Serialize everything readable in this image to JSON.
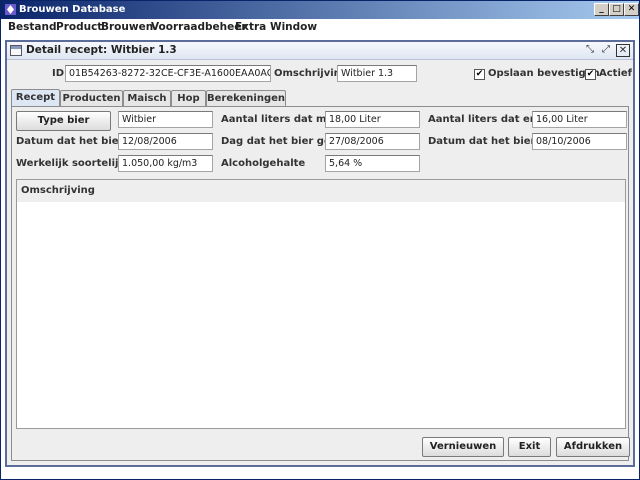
{
  "window": {
    "title": "Brouwen Database",
    "controls": [
      "_",
      "□",
      "✕"
    ]
  },
  "menu": [
    "Bestand",
    "Product",
    "Brouwen",
    "Voorraadbeheer",
    "Extra",
    "Window"
  ],
  "frame": {
    "title": "Detail recept: Witbier 1.3",
    "controls": [
      "⤡",
      "⤢",
      "✕"
    ]
  },
  "header": {
    "id_label": "ID",
    "id_value": "01B54263-8272-32CE-CF3E-A1600EAA0AC0",
    "omschrijving_label": "Omschrijving",
    "omschrijving_value": "Witbier 1.3",
    "opslaan_label": "Opslaan bevestigen",
    "opslaan_checked": true,
    "actief_label": "Actief",
    "actief_checked": true
  },
  "tabs": [
    {
      "label": "Recept",
      "active": true
    },
    {
      "label": "Producten",
      "active": false
    },
    {
      "label": "Maisch",
      "active": false
    },
    {
      "label": "Hop",
      "active": false
    },
    {
      "label": "Berekeningen",
      "active": false
    }
  ],
  "form": {
    "type_bier_button": "Type bier",
    "type_bier_value": "Witbier",
    "liters_me_label": "Aantal liters dat me...",
    "liters_me_value": "18,00 Liter",
    "liters_er_label": "Aantal liters dat er ...",
    "liters_er_value": "16,00 Liter",
    "datum1_label": "Datum dat het bier ...",
    "datum1_value": "12/08/2006",
    "dag_label": "Dag dat het bier ge...",
    "dag_value": "27/08/2006",
    "datum2_label": "Datum dat het bier ...",
    "datum2_value": "08/10/2006",
    "soortelijk_label": "Werkelijk soortelijk...",
    "soortelijk_value": "1.050,00 kg/m3",
    "alcohol_label": "Alcoholgehalte",
    "alcohol_value": "5,64 %",
    "omschrijving_section": "Omschrijving"
  },
  "buttons": {
    "vernieuwen": "Vernieuwen",
    "exit": "Exit",
    "afdrukken": "Afdrukken"
  }
}
